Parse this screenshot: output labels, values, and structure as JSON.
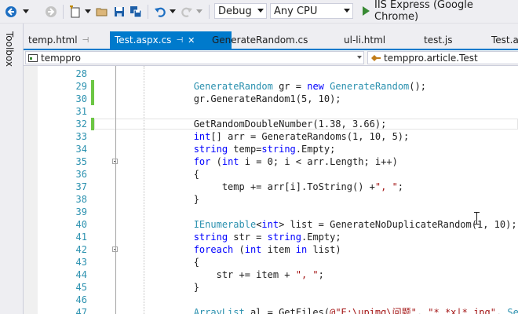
{
  "toolbar": {
    "config": "Debug",
    "platform": "Any CPU",
    "run_label": "IIS Express (Google Chrome)"
  },
  "toolbox_label": "Toolbox",
  "tabs": [
    {
      "label": "temp.html"
    },
    {
      "label": "Test.aspx.cs",
      "active": true
    },
    {
      "label": "GenerateRandom.cs"
    },
    {
      "label": "ul-li.html"
    },
    {
      "label": "test.js"
    },
    {
      "label": "Test.a"
    }
  ],
  "nav": {
    "project": "temppro",
    "member": "temppro.article.Test"
  },
  "editor": {
    "current_line": 32,
    "lines": [
      {
        "n": "28",
        "code": ""
      },
      {
        "n": "29",
        "code": "            GenerateRandom gr = new GenerateRandom();"
      },
      {
        "n": "30",
        "code": "            gr.GenerateRandom1(5, 10);"
      },
      {
        "n": "31",
        "code": ""
      },
      {
        "n": "32",
        "code": "            GetRandomDoubleNumber(1.38, 3.66);"
      },
      {
        "n": "33",
        "code": "            int[] arr = GenerateRandoms(1, 10, 5);"
      },
      {
        "n": "34",
        "code": "            string temp=string.Empty;"
      },
      {
        "n": "35",
        "code": "            for (int i = 0; i < arr.Length; i++)"
      },
      {
        "n": "36",
        "code": "            {"
      },
      {
        "n": "37",
        "code": "                 temp += arr[i].ToString() +\", \";"
      },
      {
        "n": "38",
        "code": "            }"
      },
      {
        "n": "39",
        "code": ""
      },
      {
        "n": "40",
        "code": "            IEnumerable<int> list = GenerateNoDuplicateRandom(1, 10);"
      },
      {
        "n": "41",
        "code": "            string str = string.Empty;"
      },
      {
        "n": "42",
        "code": "            foreach (int item in list)"
      },
      {
        "n": "43",
        "code": "            {"
      },
      {
        "n": "44",
        "code": "                str += item + \", \";"
      },
      {
        "n": "45",
        "code": "            }"
      },
      {
        "n": "46",
        "code": ""
      },
      {
        "n": "47",
        "code": "            ArrayList al = GetFiles(@\"E:\\upimg\\问题\", \"*.*x|*.jpg\", SearchOpt"
      }
    ]
  }
}
